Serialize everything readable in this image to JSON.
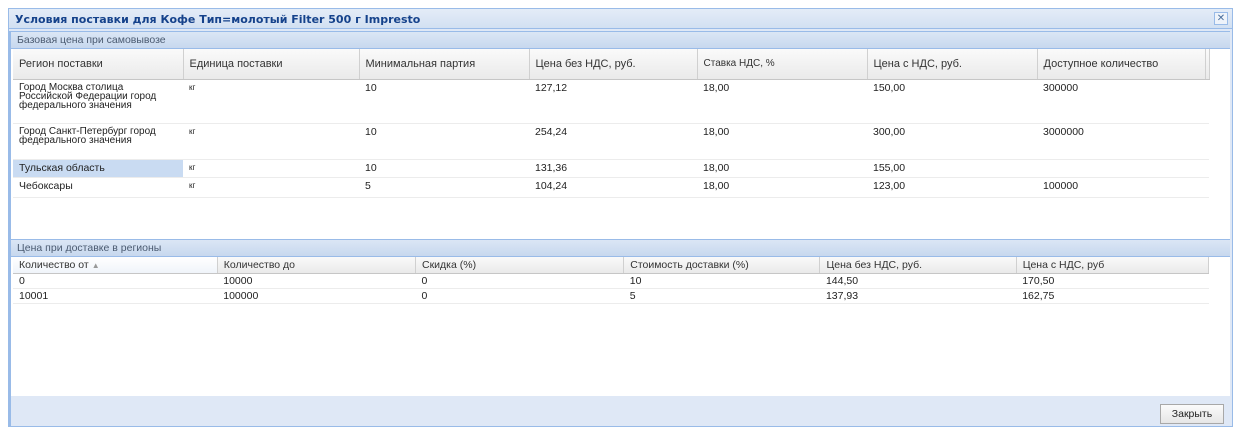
{
  "window": {
    "title": "Условия поставки для Кофе Тип=молотый Filter 500 г Impresto",
    "close_icon": "✕"
  },
  "panel1": {
    "header": "Базовая цена при самовывозе",
    "columns": [
      "Регион поставки",
      "Единица поставки",
      "Минимальная партия",
      "Цена без НДС, руб.",
      "Ставка НДС, %",
      "Цена с НДС, руб.",
      "Доступное количество"
    ],
    "rows": [
      [
        "Город Москва столица Российской Федерации город федерального значения",
        "кг",
        "10",
        "127,12",
        "18,00",
        "150,00",
        "300000"
      ],
      [
        "Город Санкт-Петербург город федерального значения",
        "кг",
        "10",
        "254,24",
        "18,00",
        "300,00",
        "3000000"
      ],
      [
        "Тульская область",
        "кг",
        "10",
        "131,36",
        "18,00",
        "155,00",
        ""
      ],
      [
        "Чебоксары",
        "кг",
        "5",
        "104,24",
        "18,00",
        "123,00",
        "100000"
      ]
    ]
  },
  "panel2": {
    "header": "Цена при доставке в регионы",
    "columns": [
      "Количество от",
      "Количество до",
      "Скидка (%)",
      "Стоимость доставки (%)",
      "Цена без НДС, руб.",
      "Цена с НДС, руб"
    ],
    "sort_icon": "▲",
    "rows": [
      [
        "0",
        "10000",
        "0",
        "10",
        "144,50",
        "170,50"
      ],
      [
        "10001",
        "100000",
        "0",
        "5",
        "137,93",
        "162,75"
      ]
    ]
  },
  "footer": {
    "close_label": "Закрыть"
  }
}
